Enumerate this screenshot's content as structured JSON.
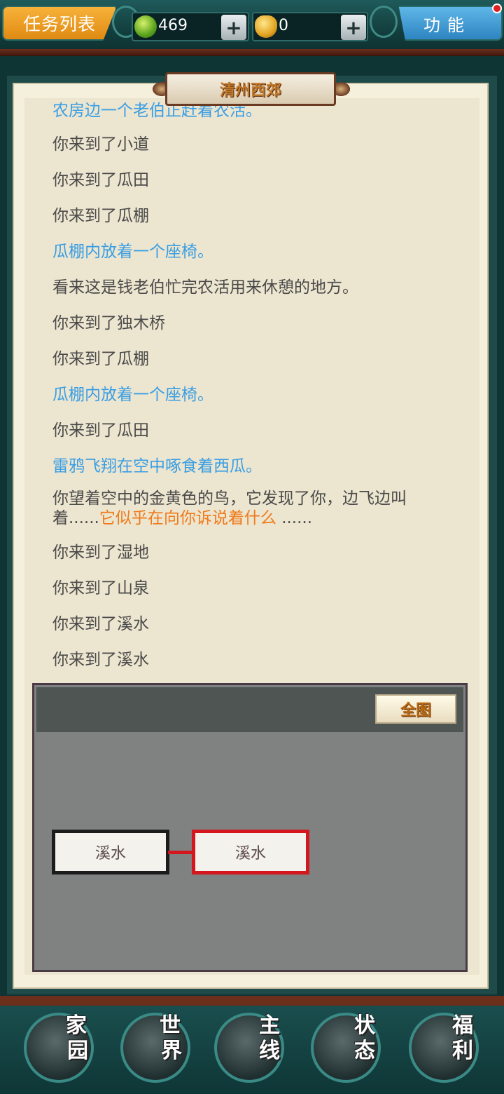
{
  "topbar": {
    "task_list_label": "任务列表",
    "jade_count": "469",
    "gold_count": "0",
    "plus_label": "+",
    "function_label": "功能"
  },
  "location": {
    "title": "清州西郊"
  },
  "log": [
    {
      "text": "农房边一个老伯正赶着农活。",
      "color": "blue"
    },
    {
      "text": "你来到了小道",
      "color": "gray"
    },
    {
      "text": "你来到了瓜田",
      "color": "gray"
    },
    {
      "text": "你来到了瓜棚",
      "color": "gray"
    },
    {
      "text": "瓜棚内放着一个座椅。",
      "color": "blue"
    },
    {
      "text": "看来这是钱老伯忙完农活用来休憩的地方。",
      "color": "gray"
    },
    {
      "text": "你来到了独木桥",
      "color": "gray"
    },
    {
      "text": "你来到了瓜棚",
      "color": "gray"
    },
    {
      "text": "瓜棚内放着一个座椅。",
      "color": "blue"
    },
    {
      "text": "你来到了瓜田",
      "color": "gray"
    },
    {
      "text": "雷鸦飞翔在空中啄食着西瓜。",
      "color": "blue"
    },
    {
      "text": "你望着空中的金黄色的鸟，它发现了你，边飞边叫着......",
      "color": "gray",
      "highlight": "它似乎在向你诉说着什么",
      "tail": "......"
    },
    {
      "text": "你来到了湿地",
      "color": "gray"
    },
    {
      "text": "你来到了山泉",
      "color": "gray"
    },
    {
      "text": "你来到了溪水",
      "color": "gray"
    },
    {
      "text": "你来到了溪水",
      "color": "gray"
    }
  ],
  "map": {
    "full_map_label": "全图",
    "nodes": [
      {
        "label": "溪水",
        "current": false
      },
      {
        "label": "溪水",
        "current": true
      }
    ]
  },
  "bottom_nav": [
    {
      "label_top": "家",
      "label_bottom": "园",
      "icon": "home-icon"
    },
    {
      "label_top": "世",
      "label_bottom": "界",
      "icon": "world-icon"
    },
    {
      "label_top": "主",
      "label_bottom": "线",
      "icon": "main-quest-icon"
    },
    {
      "label_top": "状",
      "label_bottom": "态",
      "icon": "status-icon"
    },
    {
      "label_top": "福",
      "label_bottom": "利",
      "icon": "welfare-icon"
    }
  ],
  "colors": {
    "log_blue": "#3a9ee4",
    "log_gray": "#4a4a4a",
    "log_orange": "#f07a1a",
    "current_node": "#d4161e"
  }
}
